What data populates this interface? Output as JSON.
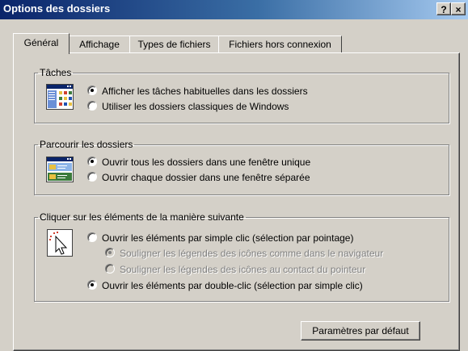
{
  "window": {
    "title": "Options des dossiers",
    "help_button": "?",
    "close_button": "×"
  },
  "tabs": [
    {
      "label": "Général",
      "active": true
    },
    {
      "label": "Affichage",
      "active": false
    },
    {
      "label": "Types de fichiers",
      "active": false
    },
    {
      "label": "Fichiers hors connexion",
      "active": false
    }
  ],
  "groups": {
    "taches": {
      "legend": "Tâches",
      "icon": "tasks-window-icon",
      "options": [
        {
          "label": "Afficher les tâches habituelles dans les dossiers",
          "selected": true
        },
        {
          "label": "Utiliser les dossiers classiques de Windows",
          "selected": false
        }
      ]
    },
    "parcourir": {
      "legend": "Parcourir les dossiers",
      "icon": "folder-window-icon",
      "options": [
        {
          "label": "Ouvrir tous les dossiers dans une fenêtre unique",
          "selected": true
        },
        {
          "label": "Ouvrir chaque dossier dans une fenêtre séparée",
          "selected": false
        }
      ]
    },
    "cliquer": {
      "legend": "Cliquer sur les éléments de la manière suivante",
      "icon": "click-cursor-icon",
      "options": [
        {
          "label": "Ouvrir les éléments par simple clic (sélection par pointage)",
          "selected": false
        },
        {
          "label": "Souligner les légendes des icônes comme dans le navigateur",
          "selected": true,
          "disabled": true
        },
        {
          "label": "Souligner les légendes des icônes au contact du pointeur",
          "selected": false,
          "disabled": true
        },
        {
          "label": "Ouvrir les éléments par double-clic (sélection par simple clic)",
          "selected": true
        }
      ]
    }
  },
  "buttons": {
    "defaults": "Paramètres par défaut"
  }
}
